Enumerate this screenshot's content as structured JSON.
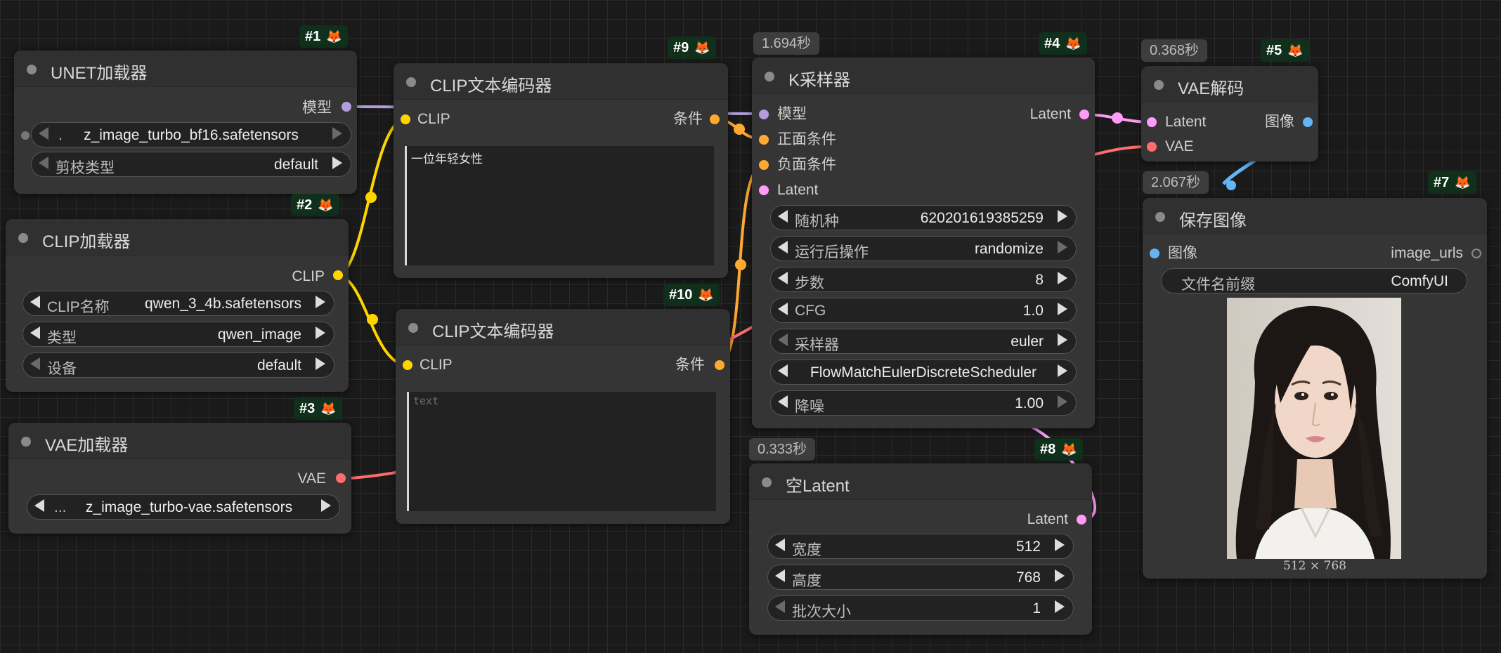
{
  "colors": {
    "model": "#b39ddb",
    "clip": "#ffd500",
    "conditioning": "#ffa931",
    "latent": "#ff9cf9",
    "vae": "#ff6e6e",
    "image": "#64b5f6",
    "neutral": "#555555"
  },
  "nodes": {
    "unet_loader": {
      "badge": "#1",
      "title": "UNET加载器",
      "output": "模型",
      "unet_name": "z_image_turbo_bf16.safetensors",
      "unet_prefix": ".",
      "weight_label": "剪枝类型",
      "weight_value": "default"
    },
    "clip_loader": {
      "badge": "#2",
      "title": "CLIP加载器",
      "output": "CLIP",
      "clip_name_label": "CLIP名称",
      "clip_name_value": "qwen_3_4b.safetensors",
      "type_label": "类型",
      "type_value": "qwen_image",
      "device_label": "设备",
      "device_value": "default"
    },
    "vae_loader": {
      "badge": "#3",
      "title": "VAE加载器",
      "output": "VAE",
      "vae_prefix": "...",
      "vae_name": "z_image_turbo-vae.safetensors"
    },
    "clip_encode_pos": {
      "badge": "#9",
      "title": "CLIP文本编码器",
      "input": "CLIP",
      "output": "条件",
      "text": "一位年轻女性"
    },
    "clip_encode_neg": {
      "badge": "#10",
      "title": "CLIP文本编码器",
      "input": "CLIP",
      "output": "条件",
      "placeholder": "text"
    },
    "ksampler": {
      "badge": "#4",
      "title": "K采样器",
      "time": "1.694秒",
      "inputs": [
        "模型",
        "正面条件",
        "负面条件",
        "Latent"
      ],
      "output": "Latent",
      "widgets": [
        {
          "label": "随机种",
          "value": "620201619385259"
        },
        {
          "label": "运行后操作",
          "value": "randomize"
        },
        {
          "label": "步数",
          "value": "8"
        },
        {
          "label": "CFG",
          "value": "1.0"
        },
        {
          "label": "采样器",
          "value": "euler"
        },
        {
          "label": "",
          "value": "FlowMatchEulerDiscreteScheduler"
        },
        {
          "label": "降噪",
          "value": "1.00"
        }
      ]
    },
    "vae_decode": {
      "badge": "#5",
      "title": "VAE解码",
      "time": "0.368秒",
      "inputs": [
        "Latent",
        "VAE"
      ],
      "output": "图像"
    },
    "save_image": {
      "badge": "#7",
      "title": "保存图像",
      "time": "2.067秒",
      "input": "图像",
      "output": "image_urls",
      "prefix_label": "文件名前缀",
      "prefix_value": "ComfyUI",
      "image_caption": "512 × 768"
    },
    "empty_latent": {
      "badge": "#8",
      "title": "空Latent",
      "time": "0.333秒",
      "output": "Latent",
      "widgets": [
        {
          "label": "宽度",
          "value": "512"
        },
        {
          "label": "高度",
          "value": "768"
        },
        {
          "label": "批次大小",
          "value": "1"
        }
      ]
    }
  }
}
